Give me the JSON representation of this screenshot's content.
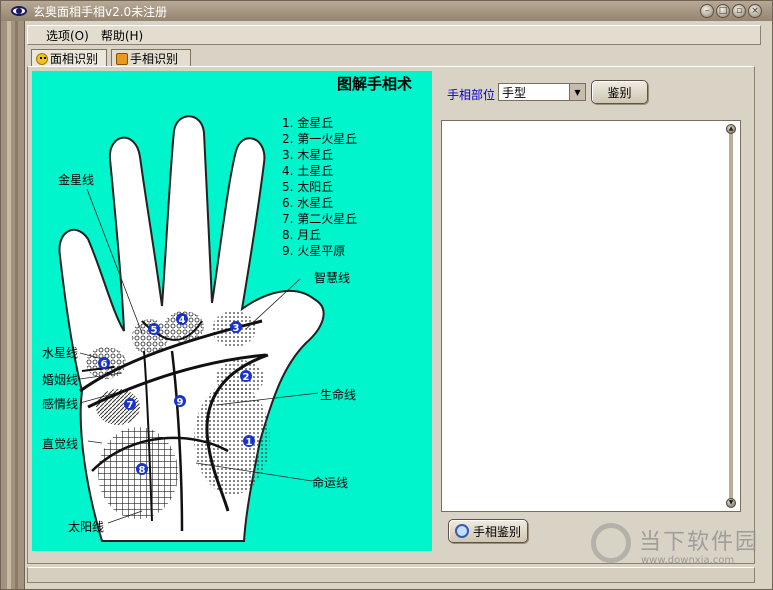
{
  "window": {
    "title": "玄奥面相手相v2.0未注册"
  },
  "title_buttons": [
    "–",
    "□",
    "▫",
    "×"
  ],
  "menu": [
    {
      "label": "选项(O)"
    },
    {
      "label": "帮助(H)"
    }
  ],
  "tabs": [
    {
      "label": "面相识别",
      "icon": "smiley-icon"
    },
    {
      "label": "手相识别",
      "icon": "hand-icon"
    }
  ],
  "illustration": {
    "title": "图解手相术",
    "legend": [
      "1.  金星丘",
      "2.  第一火星丘",
      "3.  木星丘",
      "4.  土星丘",
      "5.  太阳丘",
      "6. 水星丘",
      "7.  第二火星丘",
      "8. 月丘",
      "9.  火星平原"
    ],
    "line_labels": {
      "venus": "金星线",
      "wisdom": "智慧线",
      "mercury": "水星线",
      "marriage": "婚姻线",
      "heart": "感情线",
      "life": "生命线",
      "intuition": "直觉线",
      "fate": "命运线",
      "sun": "太阳线"
    },
    "mount_numbers": [
      "1",
      "2",
      "3",
      "4",
      "5",
      "6",
      "7",
      "8",
      "9"
    ]
  },
  "controls": {
    "part_label": "手相部位",
    "part_value": "手型",
    "identify_button": "鉴别",
    "hand_identify_button": "手相鉴别",
    "result_text": ""
  },
  "watermark": {
    "brand": "当下软件园",
    "url": "www.downxia.com"
  }
}
